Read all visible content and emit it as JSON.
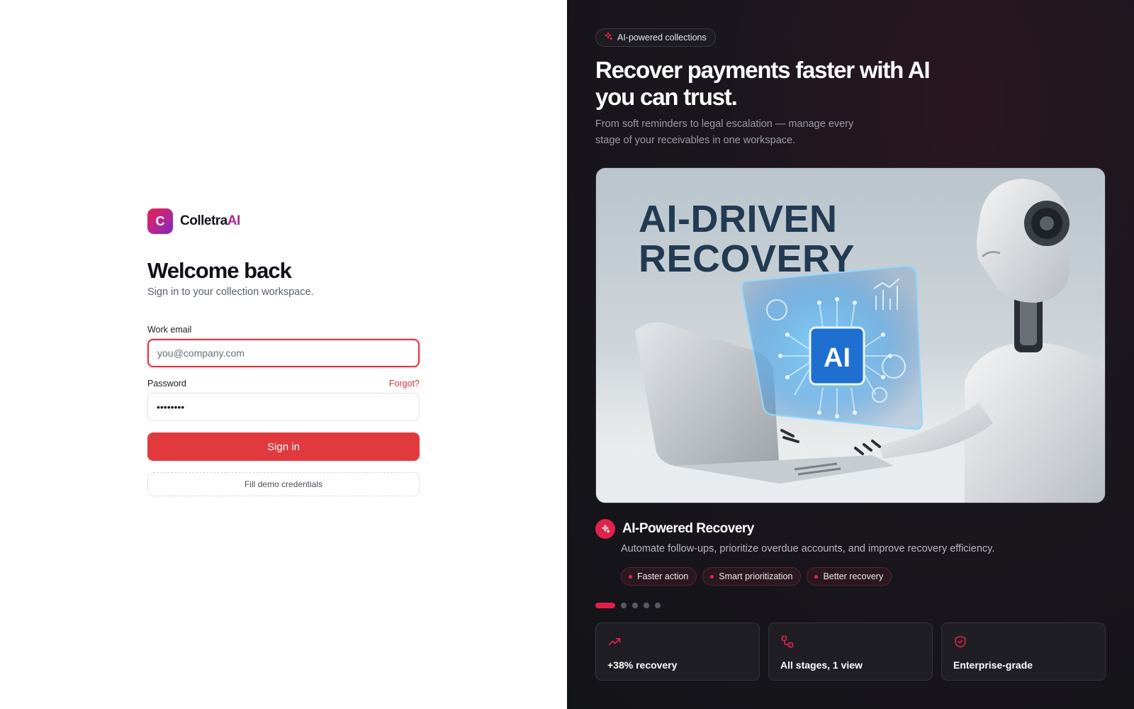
{
  "brand": {
    "logo_letter": "C",
    "name_main": "Colletra",
    "name_accent": "AI"
  },
  "login": {
    "title": "Welcome back",
    "subtitle": "Sign in to your collection workspace.",
    "email_label": "Work email",
    "email_placeholder": "you@company.com",
    "password_label": "Password",
    "forgot_label": "Forgot?",
    "password_value": "••••••••",
    "signin_label": "Sign in",
    "demo_label": "Fill demo credentials"
  },
  "promo": {
    "pill_label": "AI-powered collections",
    "headline": "Recover payments faster with AI you can trust.",
    "subheadline": "From soft reminders to legal escalation — manage every stage of your receivables in one workspace.",
    "image": {
      "title_line1": "AI-DRIVEN",
      "title_line2": "RECOVERY",
      "chip_label": "AI"
    },
    "feature": {
      "title": "AI-Powered Recovery",
      "description": "Automate follow-ups, prioritize overdue accounts, and improve recovery efficiency.",
      "tags": [
        "Faster action",
        "Smart prioritization",
        "Better recovery"
      ]
    },
    "carousel": {
      "total": 5,
      "active_index": 0
    },
    "stats": [
      {
        "icon": "trending-up-icon",
        "label": "+38% recovery"
      },
      {
        "icon": "workflow-icon",
        "label": "All stages, 1 view"
      },
      {
        "icon": "shield-check-icon",
        "label": "Enterprise-grade"
      }
    ]
  },
  "colors": {
    "accent": "#e0224a",
    "button": "#e03a3e",
    "dark_bg": "#16161b"
  }
}
